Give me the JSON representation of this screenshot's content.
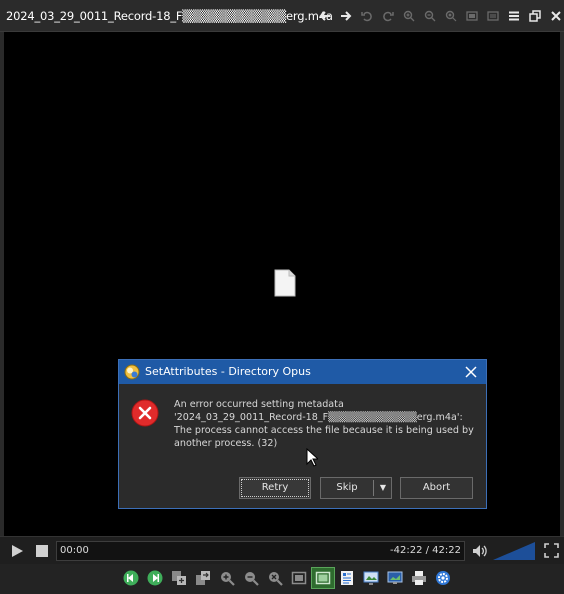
{
  "window": {
    "title": "2024_03_29_0011_Record-18_F▒▒▒▒▒▒▒▒▒▒▒▒erg.m4a"
  },
  "titlebar_icons": [
    "back-arrow-icon",
    "forward-arrow-icon",
    "rotate-left-icon",
    "rotate-right-icon",
    "zoom-in-icon",
    "zoom-out-icon",
    "zoom-fit-icon",
    "fit-window-icon",
    "full-size-icon",
    "menu-icon",
    "restore-icon",
    "close-icon"
  ],
  "dialog": {
    "title": "SetAttributes - Directory Opus",
    "message_lines": [
      "An error occurred setting metadata",
      "'2024_03_29_0011_Record-18_F▒▒▒▒▒▒▒▒▒▒▒▒erg.m4a':",
      "The process cannot access the file because it is being used by",
      "another process. (32)"
    ],
    "buttons": {
      "retry": "Retry",
      "skip": "Skip",
      "abort": "Abort"
    },
    "colors": {
      "title_bar": "#1f5aa6",
      "error": "#e02b2b"
    }
  },
  "playback": {
    "current_time": "00:00",
    "remaining_total": "-42:22 / 42:22"
  },
  "bottom_toolbar": {
    "icons": [
      "previous-icon",
      "next-icon",
      "add-to-collection-icon",
      "copy-to-icon",
      "zoom-in-icon",
      "zoom-out-icon",
      "zoom-reset-icon",
      "fit-icon",
      "fit-window-icon",
      "info-icon",
      "slideshow-icon",
      "set-wallpaper-icon",
      "print-icon",
      "settings-icon"
    ],
    "selected": "fit-window-icon"
  }
}
